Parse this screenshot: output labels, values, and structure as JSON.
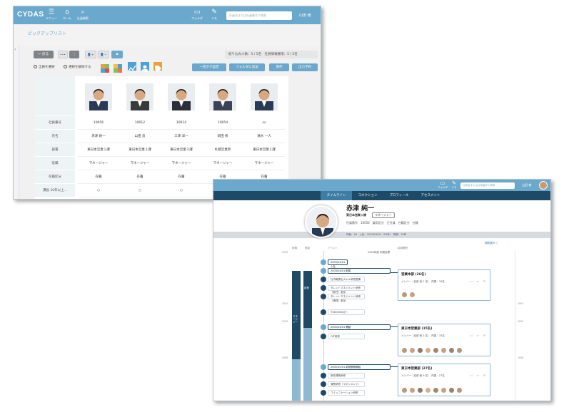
{
  "w1": {
    "logo": "CYDAS",
    "nav": [
      {
        "icon": "☰",
        "label": "メニュー"
      },
      {
        "icon": "⌂",
        "label": "ホーム"
      },
      {
        "icon": "⌕",
        "label": "社員検索"
      }
    ],
    "nav_right": [
      {
        "icon": "▭",
        "label": "フォルダ"
      },
      {
        "icon": "✎",
        "label": "メモ"
      }
    ],
    "search_placeholder": "社員名または社員番号で検索",
    "user": "山田 様",
    "page_title": "ピックアップリスト",
    "sidebar_toggle": "›",
    "back_button": "← 戻る",
    "more_button": "•••",
    "dots_button": "⋮",
    "add_person_button": "👤+",
    "remove_person_button": "👤−",
    "view_button": "⧉",
    "counts": "絞り込み人数：5 / 5名　社員情報権限：5 / 5名",
    "select_all": "全員を選択",
    "deselect_all": "選択を解除する",
    "tag_button": "一括タグ設定",
    "folder_button": "フォルダに追加",
    "save_button": "保存",
    "export_button": "出力予約",
    "row_labels": [
      "社員番号",
      "氏名",
      "部署",
      "役職",
      "在籍区分",
      "課長 10年以上..."
    ],
    "rows": [
      [
        "10056",
        "10012",
        "10014",
        "10054",
        "ss"
      ],
      [
        "赤津 純一",
        "山田 良",
        "三津 洋一",
        "岡田 修",
        "清水 一人"
      ],
      [
        "東日本営業１課",
        "東日本営業２課",
        "東日本営業３課",
        "札幌営業所",
        "東日本営業２課"
      ],
      [
        "マネージャー",
        "マネージャー",
        "マネージャー",
        "マネージャー",
        "マネージャー"
      ],
      [
        "在籍",
        "在籍",
        "在籍",
        "在籍",
        "在籍"
      ],
      [
        "○",
        "○",
        "○",
        "×",
        "×"
      ]
    ]
  },
  "w2": {
    "tabs": [
      "タイムライン",
      "コネクション",
      "プロフィール",
      "アセスメント"
    ],
    "top_icons": [
      {
        "icon": "▭",
        "label": "フォルダ"
      },
      {
        "icon": "✎",
        "label": "メモ"
      }
    ],
    "search_placeholder": "社員名または社員番号で検索",
    "user": "山田 様",
    "name": "赤津 純一",
    "dept": "東日本営業１課",
    "role": "マネージャー",
    "info_line": "社員番号　10056　雇用区分　正社員　在籍区分　在籍",
    "bar_text": "年齢：46　入社：2003/04/01（19年）　勤続：19年",
    "col_headers": [
      "役職",
      "等級",
      "イベント",
      "組織履歴"
    ],
    "years": [
      "2003",
      "2004",
      "2005",
      "2006"
    ],
    "band1_label": "マネージャー",
    "band2_label": "部長",
    "top_event": "2024年度 年間目標",
    "link_right": "期間選択 ⓘ",
    "events": [
      "2003/04/01 入社",
      "2003/04/01 配属",
      "社内報提出スキル研修受講",
      "タレントマネジメント研修（新任）参加",
      "タレントマネジメント研修（実践）参加",
      "TOEIC650点～",
      "2005/04/01 異動",
      "OJT研修",
      "2005/10/01 新規業務開始",
      "新任課長研修",
      "課長研修（マネジメント）",
      "コミュニケーション研修"
    ],
    "cards": [
      {
        "title": "営業本部 (26名)",
        "sub": "メンバー（自部 他 2 名）　所属：10名",
        "faces": 2
      },
      {
        "title": "東日本営業部 (15名)",
        "sub": "メンバー（自部 他 2 名）　所属：15名",
        "faces": 8
      },
      {
        "title": "東日本営業部 (27名)",
        "sub": "メンバー（自部 他 9 名）　所属：27名",
        "faces": 8
      }
    ]
  },
  "colors": {
    "accent": "#6aa9cc",
    "navy": "#1e4a68",
    "light_blue": "#8fb8d4"
  }
}
